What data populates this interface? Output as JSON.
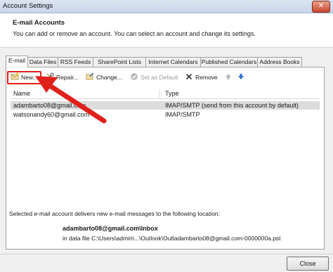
{
  "window": {
    "title": "Account Settings",
    "close_glyph": "✕"
  },
  "header": {
    "title": "E-mail Accounts",
    "subtitle": "You can add or remove an account. You can select an account and change its settings."
  },
  "tabs": [
    "E-mail",
    "Data Files",
    "RSS Feeds",
    "SharePoint Lists",
    "Internet Calendars",
    "Published Calendars",
    "Address Books"
  ],
  "toolbar": {
    "new_label": "New...",
    "repair_label": "Repair...",
    "change_label": "Change...",
    "set_default_label": "Set as Default",
    "remove_label": "Remove"
  },
  "list": {
    "columns": [
      "Name",
      "Type"
    ],
    "rows": [
      {
        "name": "adambarto08@gmail.com",
        "type": "IMAP/SMTP (send from this account by default)"
      },
      {
        "name": "watsonandy60@gmail.com",
        "type": "IMAP/SMTP"
      }
    ]
  },
  "location": {
    "description": "Selected e-mail account delivers new e-mail messages to the following location:",
    "mailbox": "adambarto08@gmail.com\\Inbox",
    "path": "in data file C:\\Users\\admin\\...\\Outlook\\Outladambarto08@gmail.com-0000000a.pst"
  },
  "footer": {
    "close_label": "Close"
  },
  "colors": {
    "annotation": "#e0201b",
    "selected_row": "#dcdcdc"
  }
}
